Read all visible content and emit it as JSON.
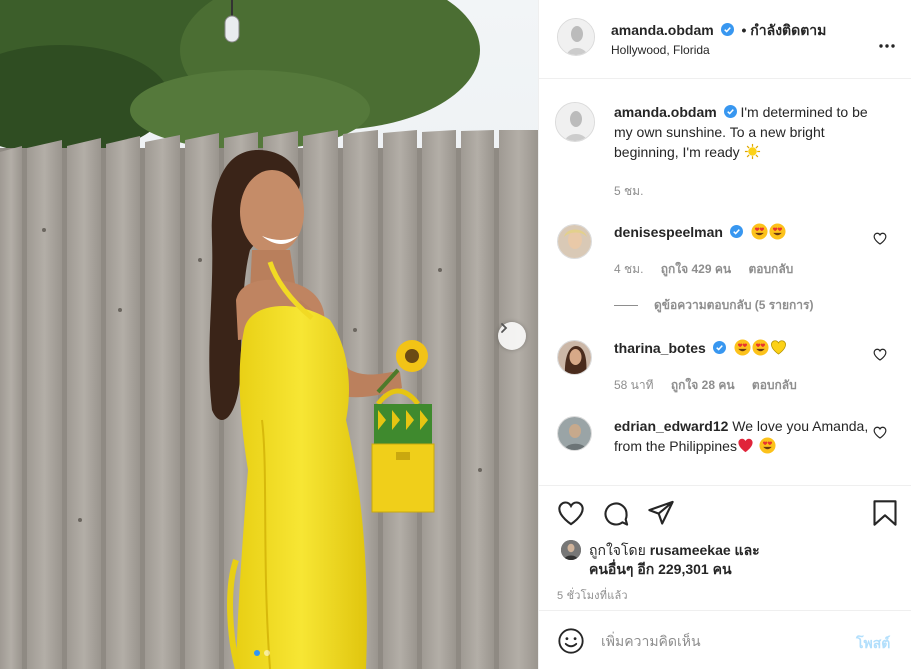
{
  "post": {
    "author": "amanda.obdam",
    "follow_status": "• กำลังติดตาม",
    "location": "Hollywood, Florida",
    "carousel": {
      "total": 2,
      "active": 1
    }
  },
  "caption": {
    "user": "amanda.obdam",
    "text": "I'm determined to be my own sunshine. To a new bright beginning, I'm ready",
    "emoji": "sun-emoji",
    "time": "5 ชม."
  },
  "comments": [
    {
      "user": "denisespeelman",
      "verified": true,
      "text": "",
      "emojis": [
        "heart-eyes-emoji",
        "heart-eyes-emoji"
      ],
      "time": "4 ชม.",
      "likes": "ถูกใจ 429 คน",
      "reply": "ตอบกลับ",
      "view_replies": "ดูข้อความตอบกลับ (5 รายการ)"
    },
    {
      "user": "tharina_botes",
      "verified": true,
      "text": "",
      "emojis": [
        "heart-eyes-emoji",
        "heart-eyes-emoji",
        "yellow-heart-emoji"
      ],
      "time": "58 นาที",
      "likes": "ถูกใจ 28 คน",
      "reply": "ตอบกลับ"
    },
    {
      "user": "edrian_edward12",
      "verified": false,
      "text": "We love you Amanda, from the Philippines",
      "emojis": [
        "red-heart-emoji",
        "heart-eyes-emoji"
      ]
    }
  ],
  "liked_by": {
    "prefix": "ถูกใจโดย",
    "user": "rusameekae",
    "suffix": "และ",
    "others": "คนอื่นๆ อีก 229,301 คน"
  },
  "time_ago": "5 ชั่วโมงที่แล้ว",
  "comment_box": {
    "placeholder": "เพิ่มความคิดเห็น",
    "post_label": "โพสต์"
  },
  "colors": {
    "verified": "#3897f0",
    "post_disabled": "#b2dffc",
    "dress": "#f5e027",
    "muted": "#8e8e8e"
  }
}
